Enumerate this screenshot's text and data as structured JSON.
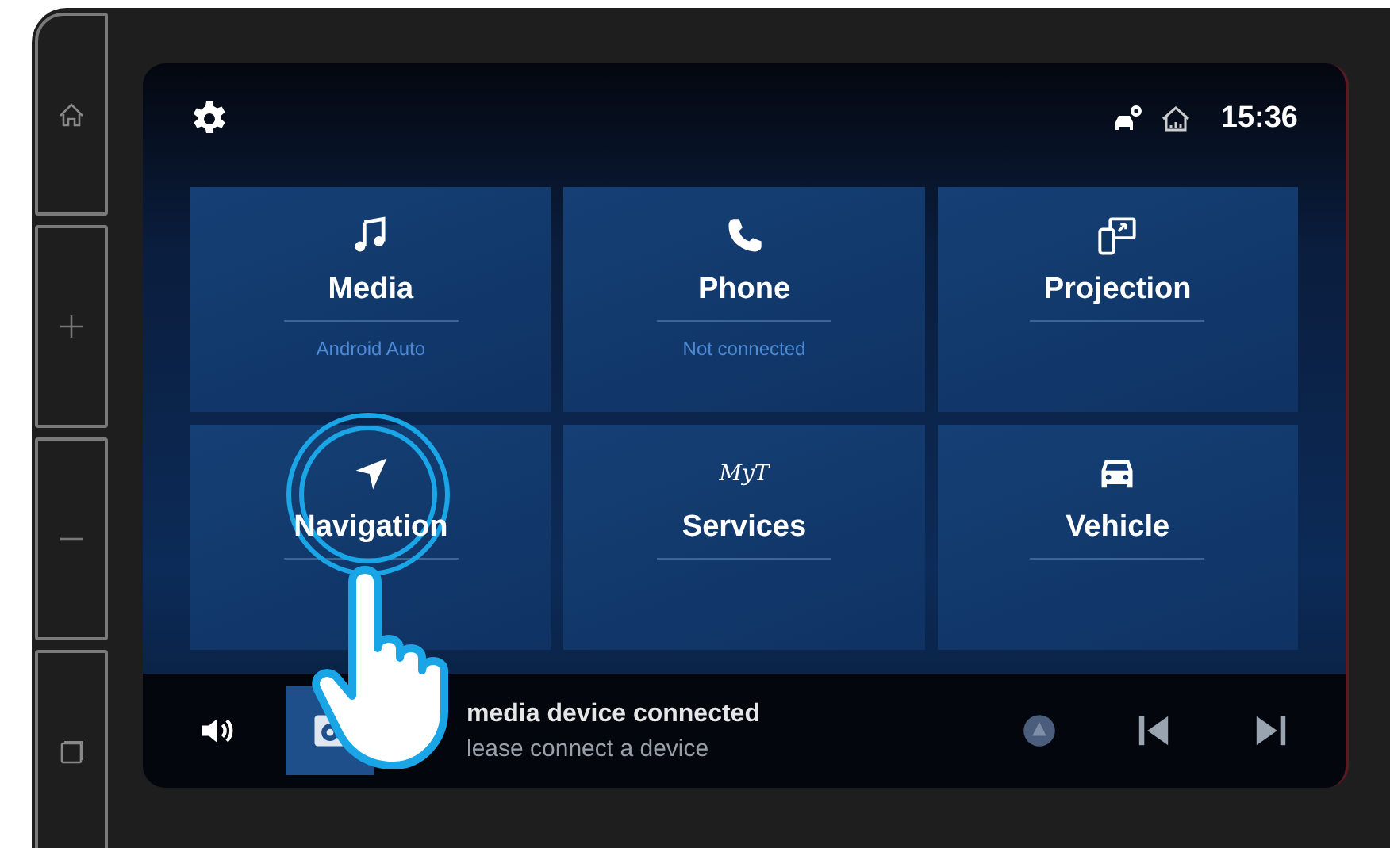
{
  "status_bar": {
    "time": "15:36"
  },
  "tiles": [
    {
      "title": "Media",
      "subtitle": "Android Auto"
    },
    {
      "title": "Phone",
      "subtitle": "Not connected"
    },
    {
      "title": "Projection"
    },
    {
      "title": "Navigation"
    },
    {
      "title": "Services",
      "logo": "MyT"
    },
    {
      "title": "Vehicle"
    }
  ],
  "now_playing": {
    "title": "media device connected",
    "subtitle": "lease connect a device"
  }
}
